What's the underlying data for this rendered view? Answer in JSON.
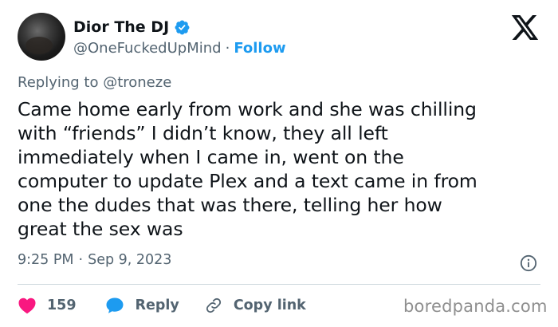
{
  "author": {
    "display_name": "Dior The DJ",
    "handle": "@OneFuckedUpMind",
    "separator": "·",
    "follow_label": "Follow",
    "verified": true
  },
  "icons": {
    "avatar": "profile-photo",
    "verified": "verified-badge-icon",
    "brand": "x-logo-icon",
    "info": "info-icon",
    "like": "heart-icon",
    "reply": "speech-bubble-icon",
    "copy": "link-icon"
  },
  "tweet": {
    "replying_to": "Replying to @troneze",
    "lines": [
      "Came home early from work and she was chilling",
      "with “friends” I didn’t know, they all left",
      "immediately when I came in, went on the",
      "computer to update Plex and a text came in from",
      "one the dudes that was there, telling her how",
      "great the sex was"
    ],
    "time": "9:25 PM",
    "meta_separator": "·",
    "date": "Sep 9, 2023"
  },
  "actions": {
    "like_count": "159",
    "reply_label": "Reply",
    "copy_link_label": "Copy link"
  },
  "watermark": "boredpanda.com",
  "colors": {
    "text": "#0f1419",
    "secondary": "#536471",
    "accent": "#1d9bf0",
    "like": "#f91880",
    "divider": "#cfd9de"
  }
}
